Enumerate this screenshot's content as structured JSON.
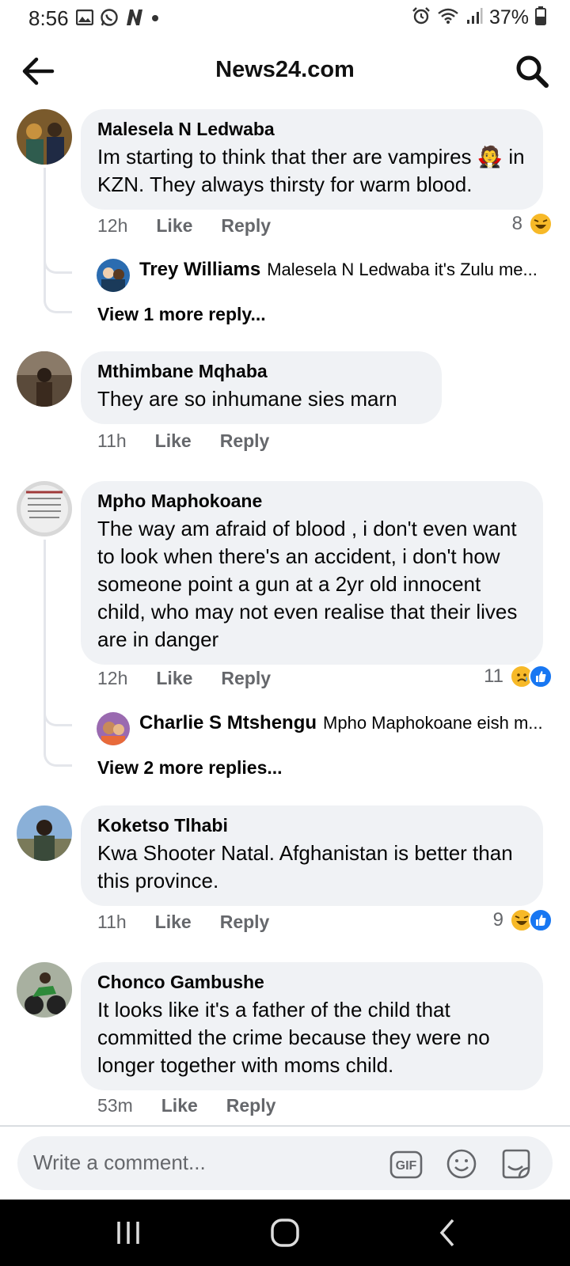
{
  "status_bar": {
    "time": "8:56",
    "battery": "37%"
  },
  "header": {
    "title": "News24.com"
  },
  "comments": [
    {
      "author": "Malesela N Ledwaba",
      "text": "Im starting to think that ther are vampires 🧛 in KZN. They always thirsty for warm blood.",
      "time": "12h",
      "like_label": "Like",
      "reply_label": "Reply",
      "reaction_count": "8",
      "reactions": [
        "laugh"
      ],
      "reply_preview": {
        "author": "Trey Williams",
        "text": "Malesela N Ledwaba it's Zulu me..."
      },
      "view_more": "View 1 more reply..."
    },
    {
      "author": "Mthimbane Mqhaba",
      "text": "They are so inhumane sies marn",
      "time": "11h",
      "like_label": "Like",
      "reply_label": "Reply"
    },
    {
      "author": "Mpho Maphokoane",
      "text": "The way am afraid of blood , i don't even want to look when there's an accident, i don't how someone point a gun at a 2yr old innocent child, who may not even realise that their lives are in danger",
      "time": "12h",
      "like_label": "Like",
      "reply_label": "Reply",
      "reaction_count": "11",
      "reactions": [
        "sad",
        "like"
      ],
      "reply_preview": {
        "author": "Charlie S Mtshengu",
        "text": "Mpho Maphokoane eish m..."
      },
      "view_more": "View 2 more replies..."
    },
    {
      "author": "Koketso Tlhabi",
      "text": "Kwa Shooter Natal. Afghanistan is better than this province.",
      "time": "11h",
      "like_label": "Like",
      "reply_label": "Reply",
      "reaction_count": "9",
      "reactions": [
        "laugh",
        "like"
      ]
    },
    {
      "author": "Chonco Gambushe",
      "text": "It looks like it's a father of the child that committed the crime because they were no longer together with moms child.",
      "time": "53m",
      "like_label": "Like",
      "reply_label": "Reply"
    }
  ],
  "composer": {
    "placeholder": "Write a comment..."
  },
  "colors": {
    "bubble": "#f0f2f5",
    "secondary_text": "#65676b",
    "like_blue": "#1877f2",
    "emoji_yellow": "#f7b928"
  }
}
